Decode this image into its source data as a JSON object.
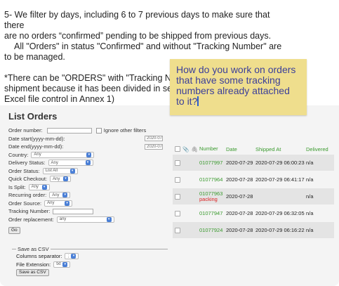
{
  "document": {
    "paragraph1_line1": "5- We filter by days, including 6 to 7 previous days to make sure that there",
    "paragraph1_line2": "are no orders “confirmed” pending to be shipped from previous days.",
    "paragraph1_line3": "All \"Orders\" in status \"Confirmed\" and without \"Tracking Number\" are",
    "paragraph1_line4": "to be managed.",
    "paragraph2_line1": "*There can be \"ORDERS\" with \"Tracking Numb",
    "paragraph2_line2": "shipment because it has been divided in sever",
    "paragraph2_line3": "Excel file control in Annex 1)"
  },
  "comment": {
    "text": "How do you work on orders that have some tracking numbers already attached to it?"
  },
  "list_orders": {
    "title": "List Orders",
    "order_number_label": "Order number:",
    "ignore_other_filters_label": "Ignore other filters",
    "date_start_label": "Date start(yyyy-mm-dd):",
    "date_start_value": "2020-07",
    "date_end_label": "Date end(yyyy-mm-dd):",
    "date_end_value": "2020-07",
    "country_label": "Country:",
    "country_value": "Any",
    "delivery_status_label": "Delivery Status:",
    "delivery_status_value": "Any",
    "order_status_label": "Order Status:",
    "order_status_value": "List All",
    "quick_checkout_label": "Quick Checkout:",
    "quick_checkout_value": "Any",
    "is_split_label": "Is Split:",
    "is_split_value": "Any",
    "recurring_order_label": "Recurring order:",
    "recurring_order_value": "Any",
    "order_source_label": "Order Source:",
    "order_source_value": "Any",
    "tracking_number_label": "Tracking Number:",
    "order_replacement_label": "Order replacement:",
    "order_replacement_value": "any",
    "go_label": "Go",
    "save_as_csv_legend": "Save as CSV",
    "columns_separator_label": "Columns separator:",
    "columns_separator_value": ";",
    "file_extension_label": "File Extension:",
    "file_extension_value": "txt",
    "save_as_csv_button": "Save as CSV"
  },
  "table": {
    "headers": {
      "number": "Number",
      "date": "Date",
      "shipped_at": "Shipped At",
      "delivered": "Delivered"
    },
    "rows": [
      {
        "number": "01077997",
        "status": "",
        "date": "2020-07-29",
        "shipped_at": "2020-07-29 06:00:23",
        "delivered": "n/a"
      },
      {
        "number": "01077964",
        "status": "",
        "date": "2020-07-28",
        "shipped_at": "2020-07-29 06:41:17",
        "delivered": "n/a"
      },
      {
        "number": "01077963",
        "status": "packing",
        "date": "2020-07-28",
        "shipped_at": "",
        "delivered": "n/a"
      },
      {
        "number": "01077947",
        "status": "",
        "date": "2020-07-28",
        "shipped_at": "2020-07-29 06:32:05",
        "delivered": "n/a"
      },
      {
        "number": "01077924",
        "status": "",
        "date": "2020-07-28",
        "shipped_at": "2020-07-29 06:16:22",
        "delivered": "n/a"
      }
    ]
  }
}
